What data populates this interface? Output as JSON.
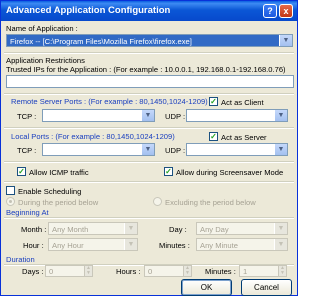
{
  "window": {
    "title": "Advanced Application Configuration",
    "help_glyph": "?",
    "close_glyph": "x"
  },
  "app_name": {
    "label": "Name of Application :",
    "value": "Firefox -- [C:\\Program Files\\Mozilla Firefox\\firefox.exe]"
  },
  "restrictions": {
    "label": "Application Restrictions",
    "trusted_label": "Trusted IPs for the Application :   (For example : 10.0.0.1, 192.168.0.1-192.168.0.76)",
    "trusted_value": ""
  },
  "remote_ports": {
    "label": "Remote Server Ports :  (For example : 80,1450,1024-1209)",
    "act_as_client": "Act as Client",
    "act_as_client_checked": true,
    "tcp_label": "TCP :",
    "tcp_value": "",
    "udp_label": "UDP :",
    "udp_value": ""
  },
  "local_ports": {
    "label": "Local Ports :  (For example : 80,1450,1024-1209)",
    "act_as_server": "Act as Server",
    "act_as_server_checked": true,
    "tcp_label": "TCP :",
    "tcp_value": "",
    "udp_label": "UDP :",
    "udp_value": ""
  },
  "options": {
    "allow_icmp": "Allow ICMP traffic",
    "allow_icmp_checked": true,
    "allow_screensaver": "Allow during Screensaver Mode",
    "allow_screensaver_checked": true
  },
  "scheduling": {
    "enable_label": "Enable Scheduling",
    "enable_checked": false,
    "during_label": "During the period below",
    "excluding_label": "Excluding the period below",
    "beginning_label": "Beginning At",
    "month_label": "Month :",
    "month_value": "Any Month",
    "day_label": "Day :",
    "day_value": "Any Day",
    "hour_label": "Hour :",
    "hour_value": "Any Hour",
    "minutes_label": "Minutes :",
    "minutes_value": "Any Minute",
    "duration_label": "Duration",
    "days_label": "Days :",
    "days_value": "0",
    "hours_label": "Hours :",
    "hours_value": "0",
    "dur_minutes_label": "Minutes :",
    "dur_minutes_value": "1"
  },
  "buttons": {
    "ok": "OK",
    "cancel": "Cancel"
  },
  "glyphs": {
    "check": "✓",
    "arrow": "▼",
    "spin_up": "▲",
    "spin_down": "▼"
  }
}
